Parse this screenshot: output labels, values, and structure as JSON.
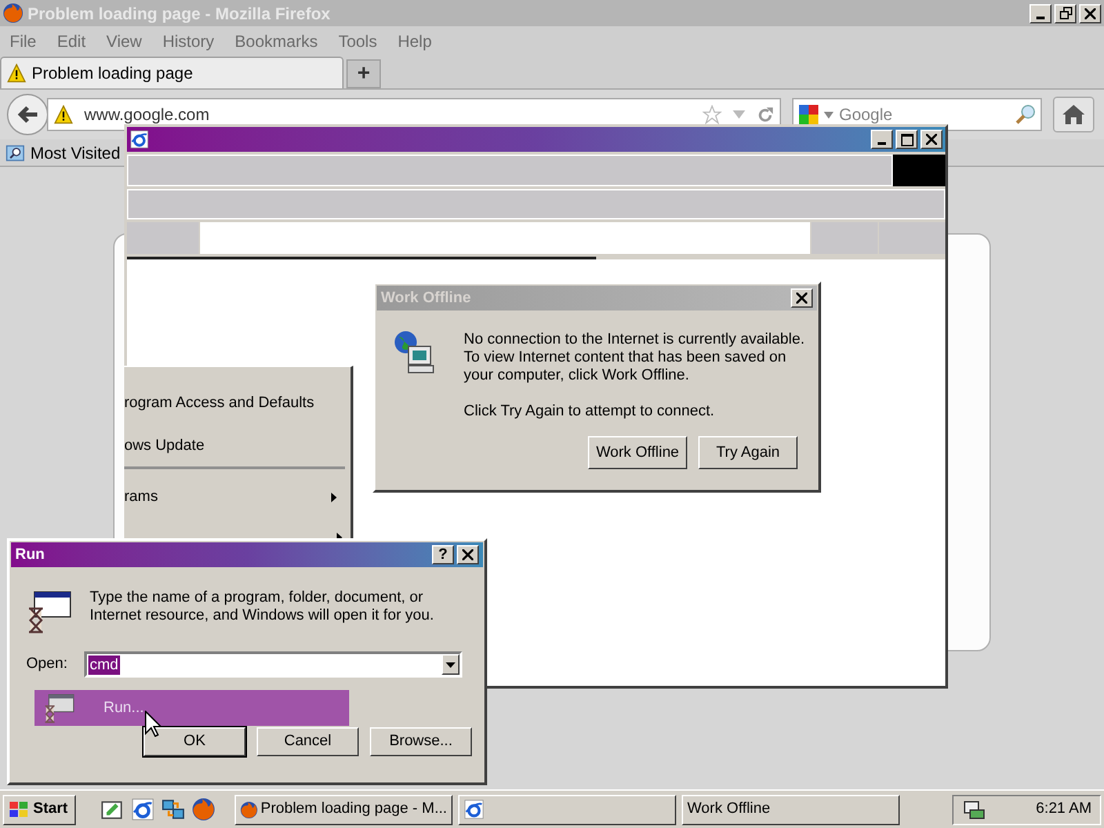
{
  "firefox": {
    "title": "Problem loading page - Mozilla Firefox",
    "menu": [
      "File",
      "Edit",
      "View",
      "History",
      "Bookmarks",
      "Tools",
      "Help"
    ],
    "tabs": [
      {
        "label": "Problem loading page",
        "selected": true
      }
    ],
    "new_tab": "+",
    "url": "www.google.com",
    "search": {
      "placeholder": "Google"
    },
    "bookmarks": [
      "Most Visited"
    ]
  },
  "start_menu": {
    "items": [
      {
        "label": "rogram Access and Defaults",
        "submenu": false
      },
      {
        "label": "ows Update",
        "submenu": false,
        "divider_after": true
      },
      {
        "label": "rams",
        "submenu": true
      }
    ]
  },
  "work_offline": {
    "title": "Work Offline",
    "message": "No connection to the Internet is currently available. To view Internet content that has been saved on your computer, click Work Offline.",
    "prompt": "Click Try Again to attempt to connect.",
    "buttons": [
      "Work Offline",
      "Try Again"
    ]
  },
  "run": {
    "title": "Run",
    "help": "?",
    "description": "Type the name of a program, folder, document, or Internet resource, and Windows will open it for you.",
    "open_label": "Open:",
    "value": "cmd",
    "buttons": [
      "OK",
      "Cancel",
      "Browse..."
    ],
    "highlight": "Run..."
  },
  "taskbar": {
    "start": "Start",
    "tasks": [
      {
        "kind": "firefox",
        "label": "Problem loading page - M..."
      },
      {
        "kind": "ie"
      },
      {
        "kind": "plain",
        "label": "Work Offline"
      }
    ],
    "clock": "6:21 AM"
  }
}
